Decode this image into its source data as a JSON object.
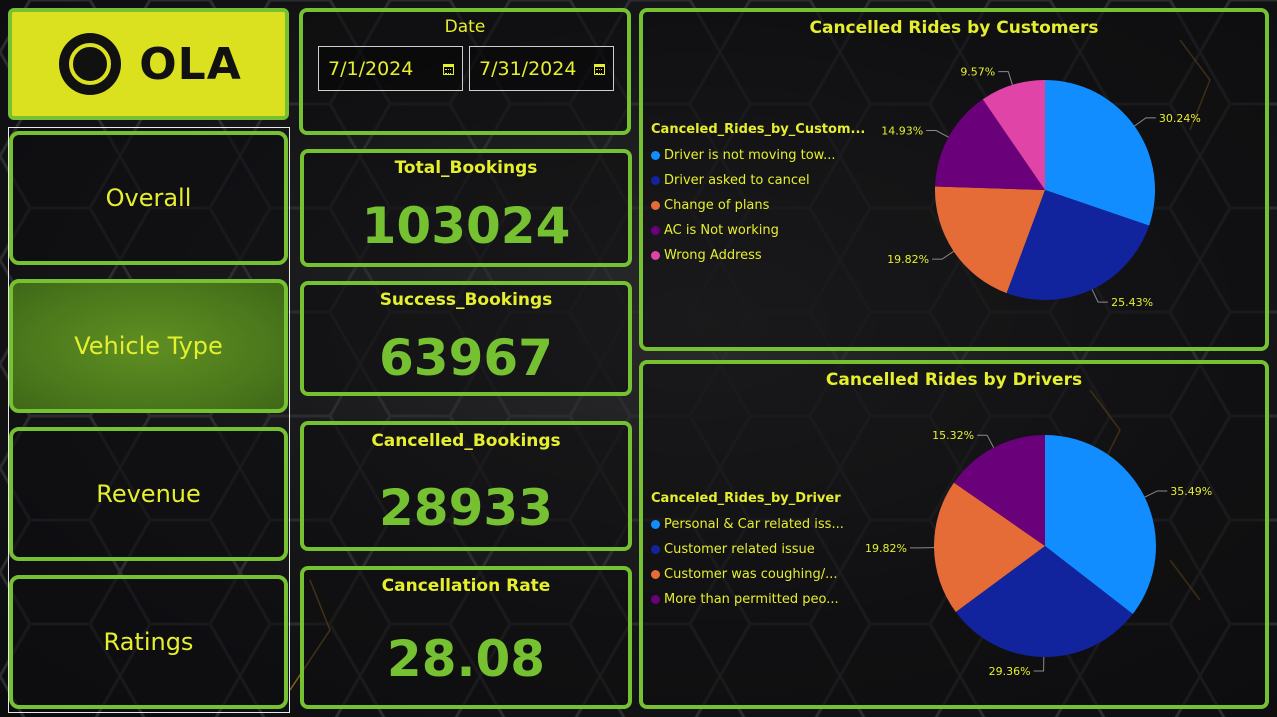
{
  "logo": {
    "text": "OLA"
  },
  "nav": {
    "items": [
      {
        "label": "Overall",
        "active": false
      },
      {
        "label": "Vehicle Type",
        "active": true
      },
      {
        "label": "Revenue",
        "active": false
      },
      {
        "label": "Ratings",
        "active": false
      }
    ]
  },
  "date_filter": {
    "title": "Date",
    "start": "7/1/2024",
    "end": "7/31/2024"
  },
  "kpis": {
    "total_bookings": {
      "label": "Total_Bookings",
      "value": "103024"
    },
    "success_bookings": {
      "label": "Success_Bookings",
      "value": "63967"
    },
    "cancelled_bookings": {
      "label": "Cancelled_Bookings",
      "value": "28933"
    },
    "cancellation_rate": {
      "label": "Cancellation Rate",
      "value": "28.08"
    }
  },
  "colors": {
    "accent_green": "#76c131",
    "title_yellow": "#e6ef2e",
    "logo_bg": "#dbe11f"
  },
  "chart_data": [
    {
      "type": "pie",
      "title": "Cancelled Rides by Customers",
      "legend_title": "Canceled_Rides_by_Custom...",
      "legend_placement": "left",
      "series": [
        {
          "name": "Driver is not moving tow...",
          "value": 30.24,
          "label": "30.24%",
          "color": "#118dff"
        },
        {
          "name": "Driver asked to cancel",
          "value": 25.43,
          "label": "25.43%",
          "color": "#12239e"
        },
        {
          "name": "Change of plans",
          "value": 19.82,
          "label": "19.82%",
          "color": "#e66c37"
        },
        {
          "name": "AC is Not working",
          "value": 14.93,
          "label": "14.93%",
          "color": "#6b007b"
        },
        {
          "name": "Wrong Address",
          "value": 9.57,
          "label": "9.57%",
          "color": "#e044a7"
        }
      ]
    },
    {
      "type": "pie",
      "title": "Cancelled Rides by Drivers",
      "legend_title": "Canceled_Rides_by_Driver",
      "legend_placement": "left",
      "series": [
        {
          "name": "Personal & Car related iss...",
          "value": 35.49,
          "label": "35.49%",
          "color": "#118dff"
        },
        {
          "name": "Customer related issue",
          "value": 29.36,
          "label": "29.36%",
          "color": "#12239e"
        },
        {
          "name": "Customer was coughing/...",
          "value": 19.82,
          "label": "19.82%",
          "color": "#e66c37"
        },
        {
          "name": "More than permitted peo...",
          "value": 15.32,
          "label": "15.32%",
          "color": "#6b007b"
        }
      ]
    }
  ]
}
